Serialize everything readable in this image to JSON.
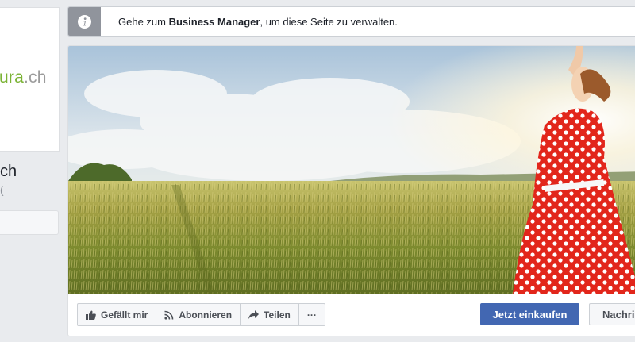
{
  "sidebar": {
    "logo_main": "ura",
    "logo_suffix": ".ch",
    "page_name": "ch",
    "page_username": "("
  },
  "banner": {
    "text_before": "Gehe zum ",
    "text_bold": "Business Manager",
    "text_after": ", um diese Seite zu verwalten."
  },
  "cover": {
    "alt": "Titelbild"
  },
  "actions": {
    "like_label": "Gefällt mir",
    "follow_label": "Abonnieren",
    "share_label": "Teilen",
    "more_label": "···",
    "shop_label": "Jetzt einkaufen",
    "message_label": "Nachricht senden"
  },
  "colors": {
    "accent": "#4267b2",
    "logo_green": "#7bb335",
    "page_bg": "#e9ebee"
  }
}
